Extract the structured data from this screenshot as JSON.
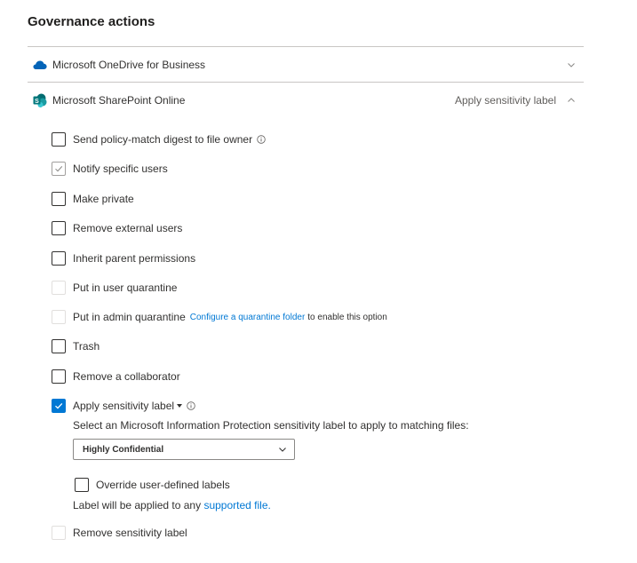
{
  "title": "Governance actions",
  "sections": [
    {
      "name": "Microsoft OneDrive for Business",
      "status": ""
    },
    {
      "name": "Microsoft SharePoint Online",
      "status": "Apply sensitivity label"
    }
  ],
  "options": {
    "send_digest": "Send policy-match digest to file owner",
    "notify_users": "Notify specific users",
    "make_private": "Make private",
    "remove_external": "Remove external users",
    "inherit_parent": "Inherit parent permissions",
    "user_quarantine": "Put in user quarantine",
    "admin_quarantine": "Put in admin quarantine",
    "admin_quarantine_link": "Configure a quarantine folder",
    "admin_quarantine_suffix": "to enable this option",
    "trash": "Trash",
    "remove_collaborator": "Remove a collaborator",
    "apply_label": "Apply sensitivity label",
    "remove_label": "Remove sensitivity label"
  },
  "apply_label_panel": {
    "instruction": "Select an Microsoft Information Protection sensitivity label to apply to matching files:",
    "selected_label": "Highly Confidential",
    "override_label": "Override user-defined labels",
    "footer_prefix": "Label will be applied to any",
    "footer_link": "supported file."
  },
  "colors": {
    "accent": "#0078d4",
    "onedrive": "#0364b8",
    "sharepoint": "#036c70"
  }
}
